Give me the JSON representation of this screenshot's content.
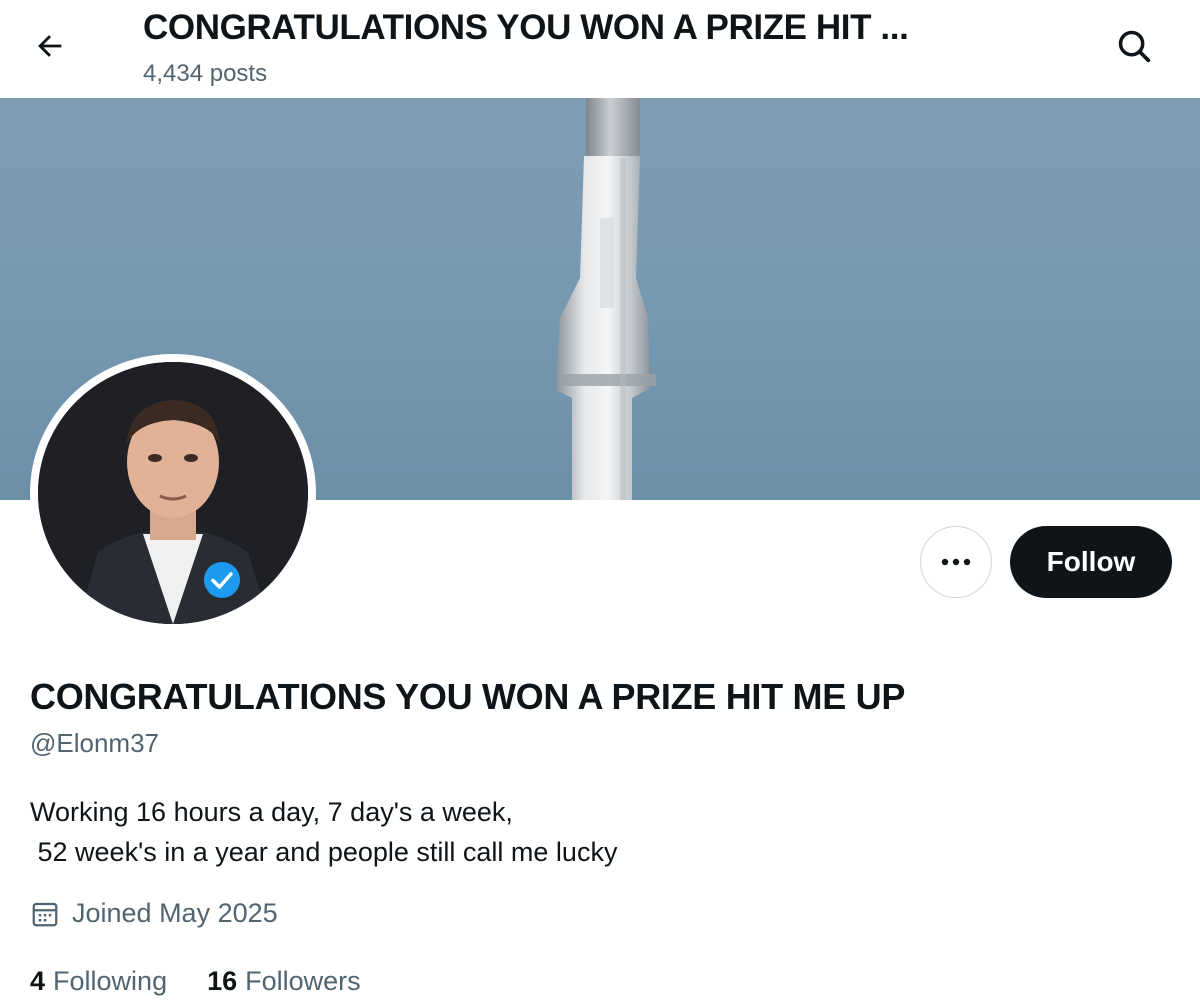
{
  "header": {
    "title": "CONGRATULATIONS YOU WON A PRIZE HIT ...",
    "post_count": "4,434 posts",
    "back_icon": "arrow-left-icon",
    "search_icon": "search-icon"
  },
  "profile": {
    "display_name": "CONGRATULATIONS YOU WON A PRIZE HIT ME UP",
    "handle": "@Elonm37",
    "bio": "Working 16 hours a day, 7 day's a week,\n 52 week's in a year and people still call me lucky",
    "joined": "Joined May 2025",
    "verified": true
  },
  "actions": {
    "more_icon": "more-horizontal-icon",
    "follow_label": "Follow"
  },
  "stats": {
    "following_count": "4",
    "following_label": "Following",
    "followers_count": "16",
    "followers_label": "Followers"
  },
  "colors": {
    "text_primary": "#0f1419",
    "text_secondary": "#536471",
    "verified_blue": "#1d9bf0",
    "banner_sky": "#7799b1",
    "button_dark": "#0f1419"
  }
}
